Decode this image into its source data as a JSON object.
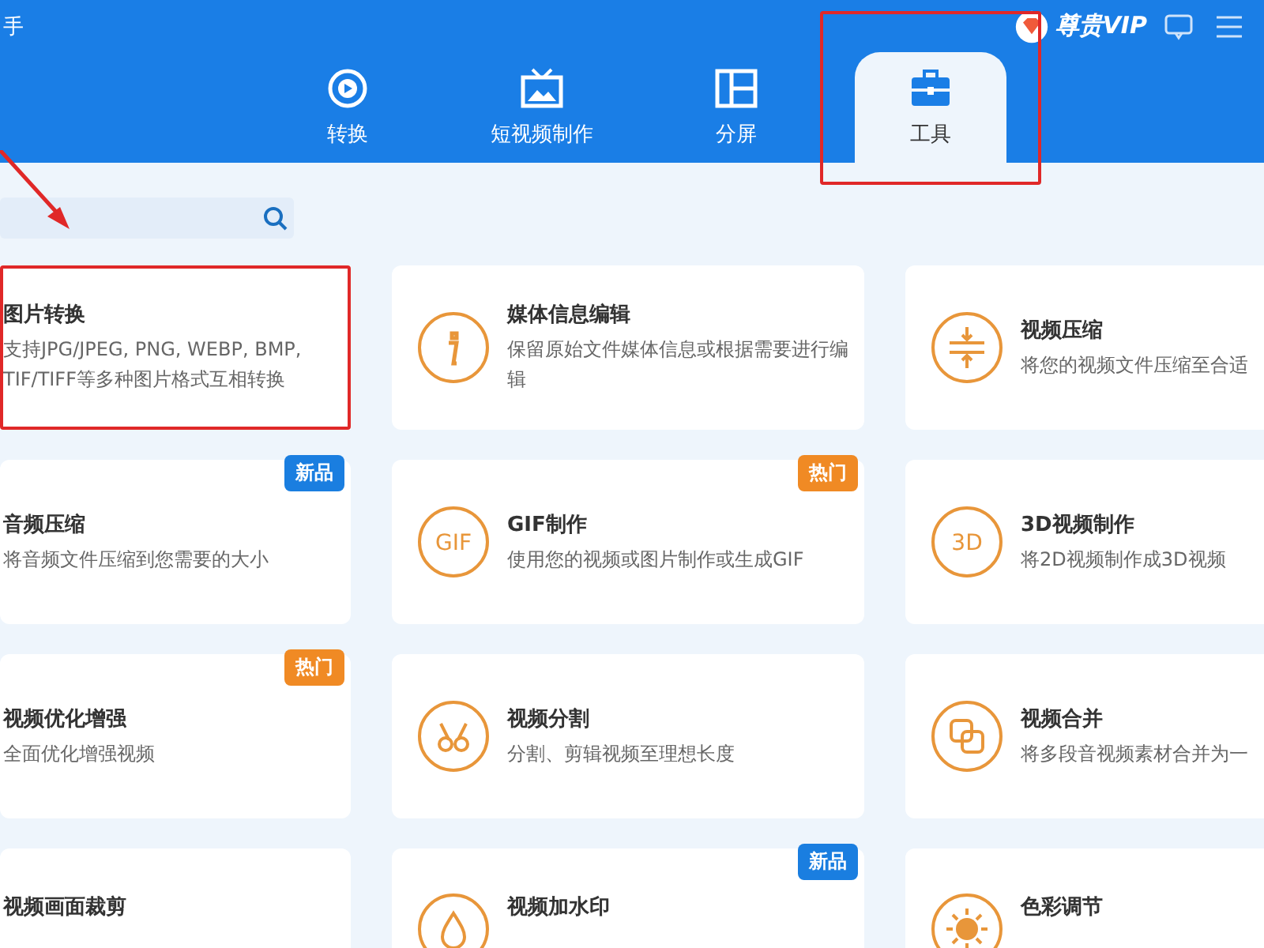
{
  "window": {
    "title": "手"
  },
  "vip": {
    "label": "尊贵VIP"
  },
  "tabs": [
    {
      "label": "转换",
      "kind": "convert",
      "selected": false,
      "highlighted": false
    },
    {
      "label": "短视频制作",
      "kind": "tv",
      "selected": false,
      "highlighted": false
    },
    {
      "label": "分屏",
      "kind": "split",
      "selected": false,
      "highlighted": false
    },
    {
      "label": "工具",
      "kind": "toolbox",
      "selected": true,
      "highlighted": true
    }
  ],
  "search": {
    "pointer_arrow": true
  },
  "cards": [
    {
      "title": "图片转换",
      "description": "支持JPG/JPEG, PNG, WEBP, BMP, TIF/TIFF等多种图片格式互相转换",
      "kind": "none",
      "highlighted": true
    },
    {
      "title": "媒体信息编辑",
      "description": "保留原始文件媒体信息或根据需要进行编辑",
      "kind": "info",
      "highlighted": false
    },
    {
      "title": "视频压缩",
      "description": "将您的视频文件压缩至合适",
      "kind": "compress",
      "highlighted": false
    },
    {
      "title": "音频压缩",
      "description": "将音频文件压缩到您需要的大小",
      "kind": "none",
      "highlighted": false,
      "badge": {
        "text": "新品",
        "color": "#1a7ee0"
      }
    },
    {
      "title": "GIF制作",
      "description": "使用您的视频或图片制作或生成GIF",
      "kind": "text",
      "icon_text": "GIF",
      "highlighted": false,
      "badge": {
        "text": "热门",
        "color": "#f08a24"
      }
    },
    {
      "title": "3D视频制作",
      "description": "将2D视频制作成3D视频",
      "kind": "text",
      "icon_text": "3D",
      "highlighted": false
    },
    {
      "title": "视频优化增强",
      "description": "全面优化增强视频",
      "kind": "none",
      "highlighted": false,
      "badge": {
        "text": "热门",
        "color": "#f08a24"
      }
    },
    {
      "title": "视频分割",
      "description": "分割、剪辑视频至理想长度",
      "kind": "scissors",
      "highlighted": false
    },
    {
      "title": "视频合并",
      "description": "将多段音视频素材合并为一",
      "kind": "merge",
      "highlighted": false
    },
    {
      "title": "视频画面裁剪",
      "kind": "none",
      "highlighted": false
    },
    {
      "title": "视频加水印",
      "kind": "drop",
      "highlighted": false,
      "badge": {
        "text": "新品",
        "color": "#1a7ee0"
      }
    },
    {
      "title": "色彩调节",
      "kind": "sun",
      "highlighted": false
    }
  ]
}
